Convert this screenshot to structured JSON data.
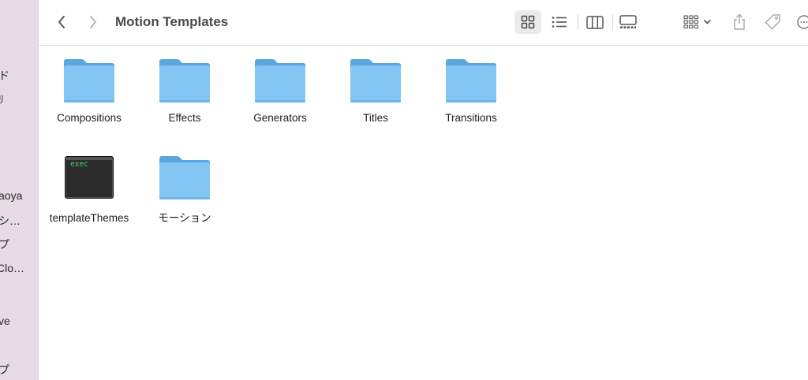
{
  "window": {
    "title": "Motion Templates"
  },
  "sidebar": {
    "items": [
      "ド",
      "ﾘ",
      "aoya",
      "シ…",
      "プ",
      "Clo…",
      "ve",
      "プ"
    ]
  },
  "toolbar": {
    "back_icon": "chevron-left-icon",
    "forward_icon": "chevron-right-icon",
    "views": [
      "icon-view",
      "list-view",
      "column-view",
      "gallery-view"
    ],
    "group_icon": "group-by-icon",
    "share_icon": "share-icon",
    "tag_icon": "tag-icon",
    "more_icon": "more-icon"
  },
  "files": {
    "items": [
      {
        "name": "Compositions",
        "kind": "folder"
      },
      {
        "name": "Effects",
        "kind": "folder"
      },
      {
        "name": "Generators",
        "kind": "folder"
      },
      {
        "name": "Titles",
        "kind": "folder"
      },
      {
        "name": "Transitions",
        "kind": "folder"
      },
      {
        "name": "templateThemes",
        "kind": "executable",
        "badge": "exec"
      },
      {
        "name": "モーション",
        "kind": "folder"
      }
    ]
  },
  "colors": {
    "folder": "#83c6f3",
    "folder_tab": "#5aa7e0",
    "sidebar": "#e6dbe4"
  }
}
